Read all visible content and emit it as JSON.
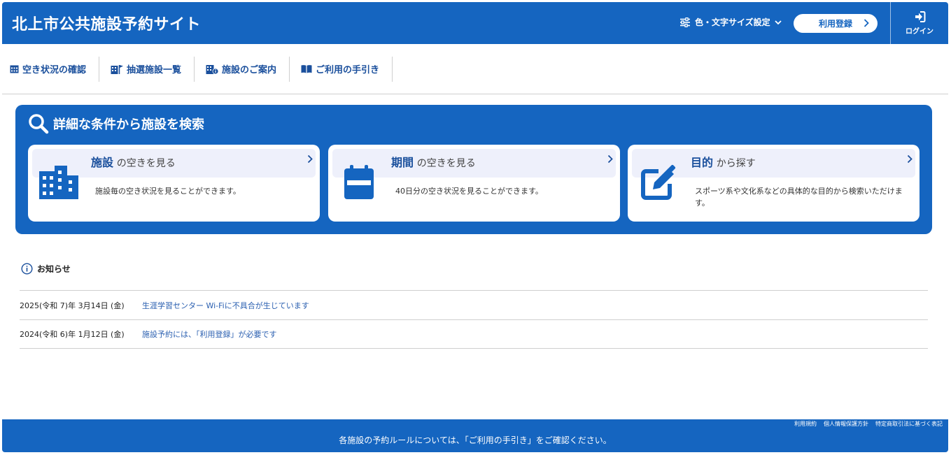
{
  "header": {
    "title": "北上市公共施設予約サイト",
    "settings_label": "色・文字サイズ設定",
    "register_label": "利用登録",
    "login_label": "ログイン"
  },
  "nav": {
    "items": [
      {
        "label": "空き状況の確認",
        "icon": "calendar-grid-icon"
      },
      {
        "label": "抽選施設一覧",
        "icon": "building-flag-icon"
      },
      {
        "label": "施設のご案内",
        "icon": "building-info-icon"
      },
      {
        "label": "ご利用の手引き",
        "icon": "book-icon"
      }
    ]
  },
  "search": {
    "title": "詳細な条件から施設を検索",
    "cards": [
      {
        "title_strong": "施設",
        "title_rest": "の空きを見る",
        "desc": "施設毎の空き状況を見ることができます。",
        "icon": "building-icon"
      },
      {
        "title_strong": "期間",
        "title_rest": "の空きを見る",
        "desc": "40日分の空き状況を見ることができます。",
        "icon": "calendar-icon"
      },
      {
        "title_strong": "目的",
        "title_rest": "から探す",
        "desc": "スポーツ系や文化系などの具体的な目的から検索いただけます。",
        "icon": "edit-icon"
      }
    ]
  },
  "notices": {
    "heading": "お知らせ",
    "items": [
      {
        "date": "2025(令和 7)年 3月14日 (金)",
        "title": "生涯学習センター Wi-Fiに不具合が生じています"
      },
      {
        "date": "2024(令和 6)年 1月12日 (金)",
        "title": "施設予約には、「利用登録」が必要です"
      }
    ]
  },
  "footer": {
    "links": [
      "利用規約",
      "個人情報保護方針",
      "特定商取引法に基づく表記"
    ],
    "note": "各施設の予約ルールについては、「ご利用の手引き」をご確認ください。"
  },
  "colors": {
    "primary": "#1565c0",
    "link": "#2a5fb0",
    "card_head": "#eef0fb"
  }
}
